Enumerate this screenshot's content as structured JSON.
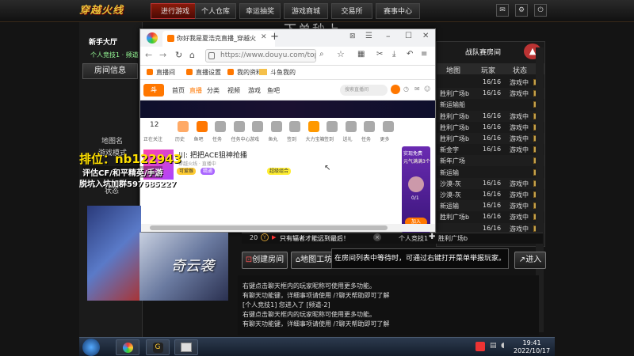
{
  "game": {
    "logo": "穿越火线",
    "nav": [
      "进行游戏",
      "个人仓库",
      "幸运抽奖",
      "游戏商城",
      "交易所",
      "赛事中心"
    ],
    "sub_header": "新手大厅",
    "room_info_label": "房间信息",
    "map_name_label": "地图名",
    "game_mode_label": "游戏模式",
    "status_label": "状态",
    "player_line": "个人竞技1 · 频道",
    "room_list": {
      "tab_label": "战队赛房间",
      "headers": [
        "地图",
        "玩家",
        "状态"
      ],
      "rows": [
        {
          "map": "",
          "players": "16/16",
          "state": "游戏中"
        },
        {
          "map": "胜利广场b",
          "players": "16/16",
          "state": "游戏中"
        },
        {
          "map": "新运输船",
          "players": "",
          "state": ""
        },
        {
          "map": "胜利广场b",
          "players": "16/16",
          "state": "游戏中"
        },
        {
          "map": "胜利广场b",
          "players": "16/16",
          "state": "游戏中"
        },
        {
          "map": "胜利广场b",
          "players": "16/16",
          "state": "游戏中"
        },
        {
          "map": "新金字",
          "players": "16/16",
          "state": "游戏中"
        },
        {
          "map": "新年广场",
          "players": "",
          "state": ""
        },
        {
          "map": "新运输",
          "players": "",
          "state": ""
        },
        {
          "map": "沙漠-灰",
          "players": "16/16",
          "state": "游戏中"
        },
        {
          "map": "沙漠-灰",
          "players": "16/16",
          "state": "游戏中"
        },
        {
          "map": "新运输",
          "players": "16/16",
          "state": "游戏中"
        },
        {
          "map": "胜利广场b",
          "players": "16/16",
          "state": "游戏中"
        },
        {
          "map": "",
          "players": "16/16",
          "state": "游戏中"
        },
        {
          "map": "胜利广场b",
          "players": "16/16",
          "state": "游戏中"
        }
      ]
    },
    "chat_count": "20",
    "chat_notice": "只有辐者才能远到最后！",
    "chat_notice_right": "个人竞技1",
    "map_partial": "胜利广场b",
    "buttons": {
      "create_room": "创建房间",
      "map_workshop": "地图工坊",
      "enter": "进入"
    },
    "tooltip": "在房间列表中等待时，可通过右键打开菜单举报玩家。",
    "chat_lines": [
      "右键点击聊天框内的玩家昵称可使用更多功能。",
      "有聊天功能键，详细事项请使用 /?聊天帮助即可了解",
      "[个人竞技1] 您进入了 [频道-2]",
      "右键点击聊天框内的玩家昵称可使用更多功能。",
      "有聊天功能键，详细事项请使用 /?聊天帮助即可了解"
    ]
  },
  "watermark": "下单秒上",
  "overlay": {
    "rank": "排位：nb122943",
    "line2": "评估CF/和平精英/手游",
    "line3": "脱坑入坑加群597685227"
  },
  "ad_big_text": "奇云袭",
  "browser": {
    "tab_title": "你好我是夏浩克直播_穿越火",
    "url": "https://www.douyu.com/topic,",
    "bookmarks": [
      "直播间",
      "直播设置",
      "我的资料",
      "斗鱼我的"
    ],
    "douyu_nav": [
      "首页",
      "直播",
      "分类",
      "视频",
      "游戏",
      "鱼吧"
    ],
    "search_placeholder": "搜索直播间",
    "follow_count": "12",
    "follow_label": "正在关注",
    "icon_labels": [
      "历史",
      "鱼吧",
      "任务",
      "任务中心",
      "游戏",
      "鱼丸",
      "签到",
      "大力宝箱",
      "签到",
      "送礼",
      "任务",
      "更多"
    ],
    "stream_title": "川: 把把ACE狙神抢播",
    "stream_meta": "穿越火线 · 直播中",
    "stream_tags": [
      "可爱猴",
      "精通",
      "超级组合"
    ],
    "side_ad": {
      "title": "实现免费",
      "sub": "元气满满3个",
      "num": "0/1",
      "cta": "加入"
    }
  },
  "taskbar": {
    "time": "19:41",
    "date": "2022/10/17"
  },
  "colors": {
    "accent_red": "#8a1a0a",
    "gold": "#e8c23a",
    "douyu_orange": "#ff7700",
    "taskbar": "#1c2838"
  }
}
